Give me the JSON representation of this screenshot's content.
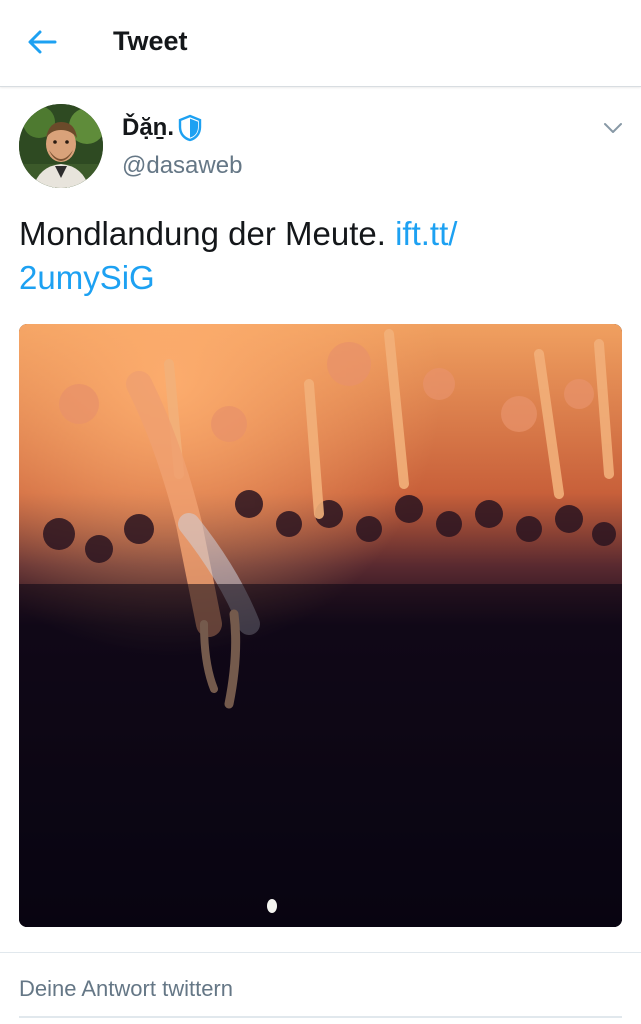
{
  "colors": {
    "accent": "#1da1f2",
    "text_primary": "#14171a",
    "text_secondary": "#657786",
    "verified_badge": "#1da1f2"
  },
  "header": {
    "title": "Tweet",
    "back_icon": "arrow-left-icon"
  },
  "tweet": {
    "author": {
      "display_name": "Ďặṉ.",
      "handle": "@dasaweb",
      "badge_icon": "shield-icon"
    },
    "text": "Mondlandung der Meute.",
    "link_line1": "ift.tt/",
    "link_line2": "2umySiG",
    "menu_icon": "chevron-down-icon"
  },
  "reply": {
    "placeholder": "Deine Antwort twittern"
  }
}
